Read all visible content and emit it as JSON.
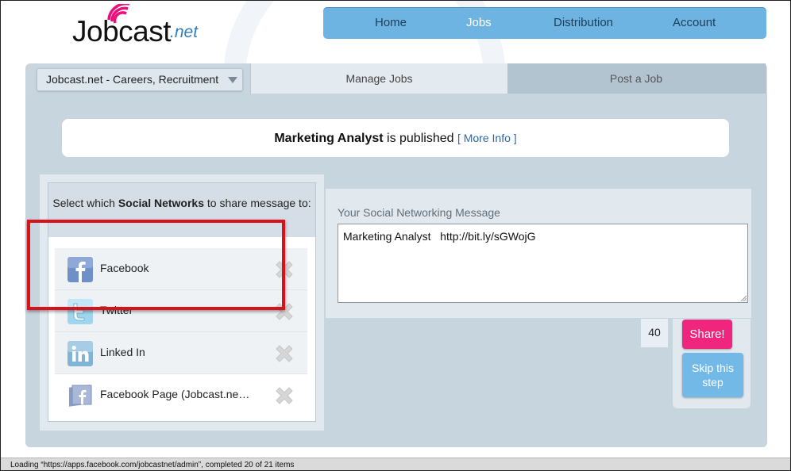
{
  "logo": {
    "brand": "Jobcast",
    "tld": ".net"
  },
  "topnav": {
    "items": [
      {
        "label": "Home"
      },
      {
        "label": "Jobs"
      },
      {
        "label": "Distribution"
      },
      {
        "label": "Account"
      }
    ],
    "active": "Jobs"
  },
  "site_select": {
    "value": "Jobcast.net - Careers, Recruitment"
  },
  "tabs": {
    "manage": "Manage Jobs",
    "post": "Post a Job"
  },
  "status": {
    "job_title": "Marketing Analyst",
    "suffix": " is published ",
    "more_info": "[ More Info ]"
  },
  "social": {
    "heading_pre": "Select which ",
    "heading_bold": "Social Networks",
    "heading_post": " to share message to:",
    "networks": [
      {
        "label": "Facebook",
        "icon": "facebook-icon"
      },
      {
        "label": "Twitter",
        "icon": "twitter-icon"
      },
      {
        "label": "Linked In",
        "icon": "linkedin-icon"
      },
      {
        "label": "Facebook Page (Jobcast.ne…",
        "icon": "facebook-page-icon"
      }
    ]
  },
  "message": {
    "label": "Your Social Networking Message",
    "text": "Marketing Analyst   http://bit.ly/sGWojG",
    "char_count": "40"
  },
  "buttons": {
    "share": "Share!",
    "skip": "Skip this step"
  },
  "statusbar": {
    "text": "Loading “https://apps.facebook.com/jobcastnet/admin”, completed 20 of 21 items"
  },
  "colors": {
    "nav": "#6eb4e3",
    "share": "#f0257d",
    "skip": "#72b9e8",
    "highlight": "#d8121b"
  }
}
